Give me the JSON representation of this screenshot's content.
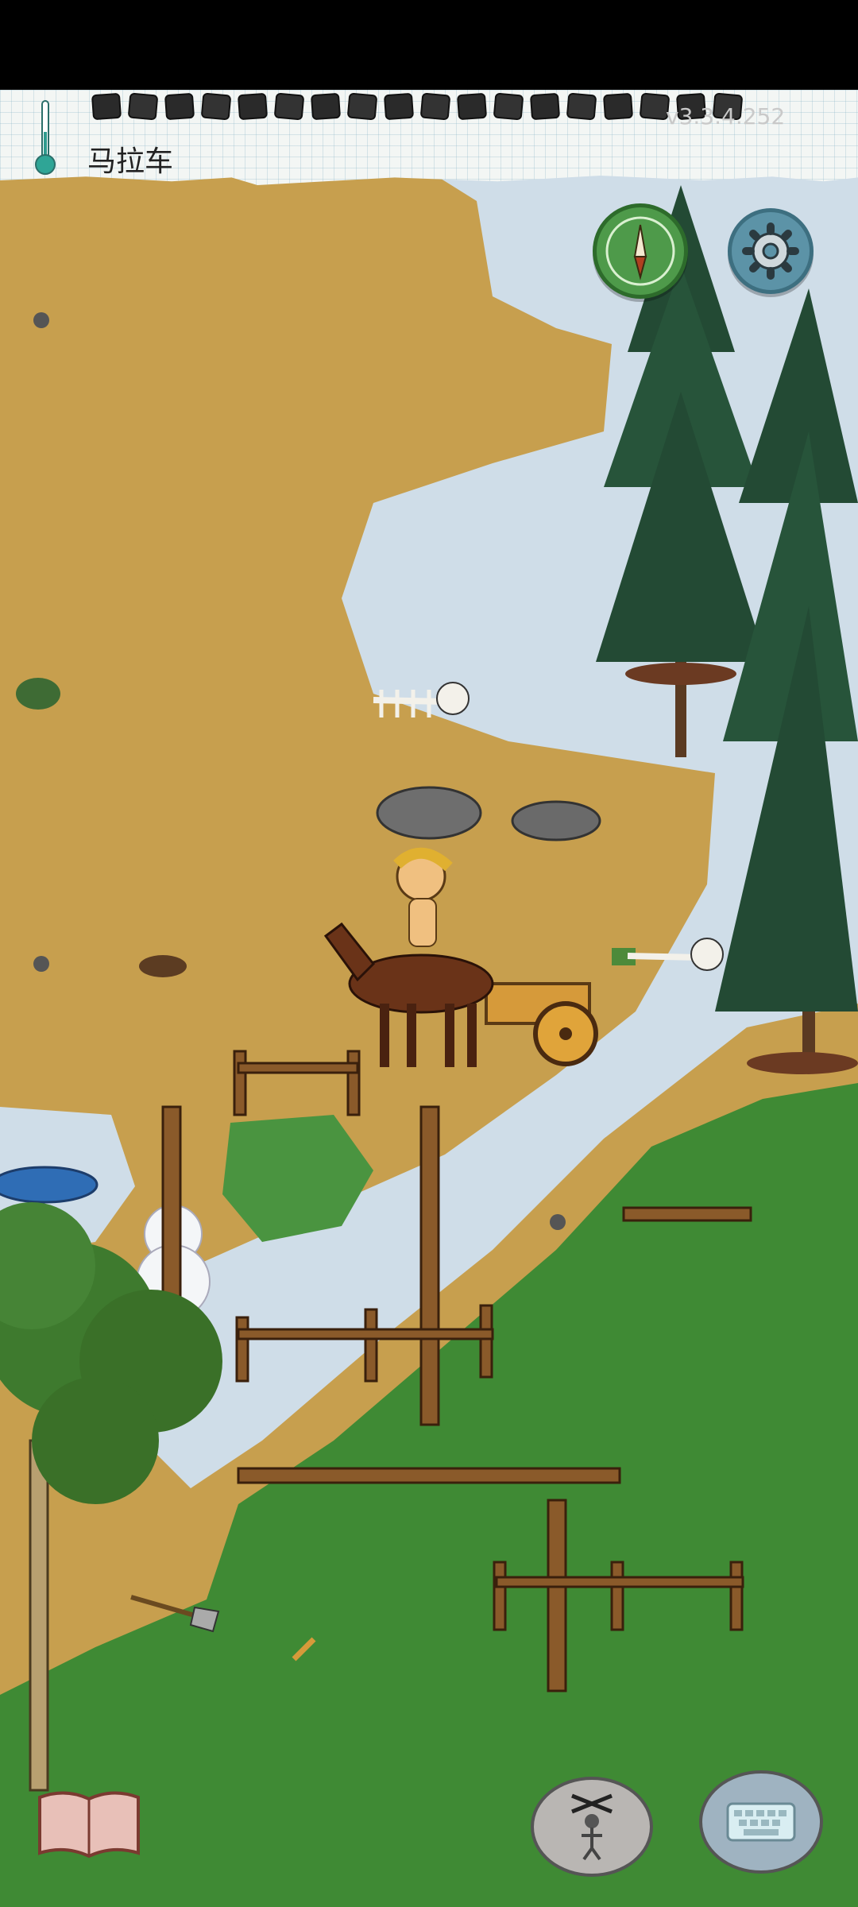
{
  "hud": {
    "held_object": "马拉车",
    "version": "v3.3.4.252",
    "hunger_pips": 18,
    "icons": [
      "thermometer-icon",
      "compass-icon",
      "gear-icon",
      "book-icon",
      "puppet-emote-icon",
      "keyboard-icon"
    ]
  },
  "colors": {
    "ground": "#c79f4e",
    "snow": "#cfdde8",
    "grass": "#3f8a34",
    "tree": "#234a34",
    "compass": "#4e9a4a",
    "settings": "#5c93a7"
  }
}
